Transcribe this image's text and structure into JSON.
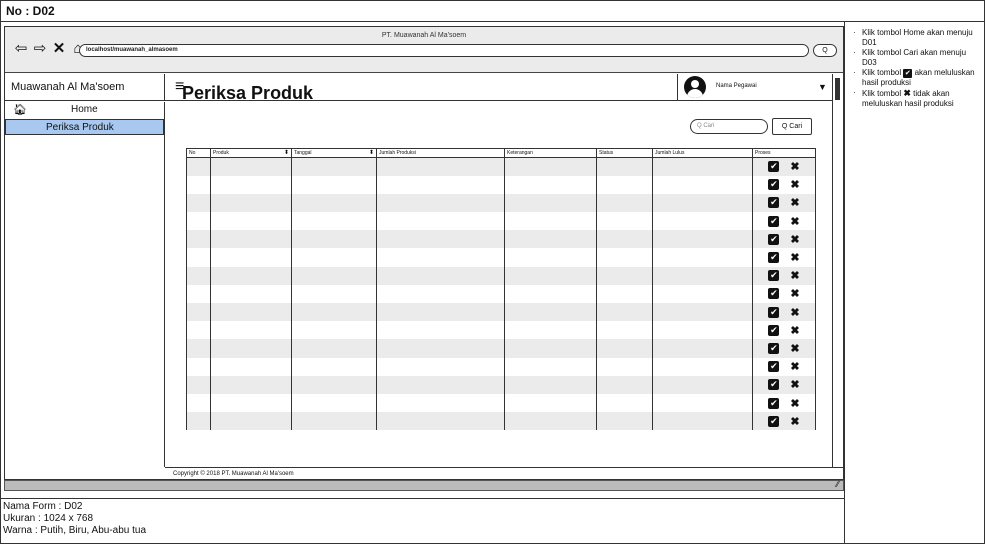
{
  "doc_id": "No : D02",
  "browser": {
    "window_title": "PT. Muawanah Al Ma'soem",
    "url": "localhost/muawanah_almasoem",
    "go_label": "Q"
  },
  "app": {
    "brand": "Muawanah Al Ma'soem",
    "hamburger": "≡",
    "user_name": "Nama Pegawai"
  },
  "sidebar": {
    "items": [
      {
        "label": "Home"
      },
      {
        "label": "Periksa Produk"
      }
    ]
  },
  "main": {
    "title": "Periksa Produk",
    "search_placeholder": "Q Cari",
    "search_button": "Q Cari",
    "columns": [
      "No",
      "Produk",
      "Tanggal",
      "Jumlah Produksi",
      "Keterangan",
      "Status",
      "Jumlah Lulus",
      "Proses"
    ],
    "row_count": 15
  },
  "footer": {
    "copyright": "Copyright © 2018 PT. Muawanah Al Ma'soem"
  },
  "form_info": {
    "name": "Nama Form : D02",
    "size": "Ukuran : 1024 x 768",
    "color": "Warna : Putih, Biru, Abu-abu tua"
  },
  "notes": {
    "n1": "Klik tombol Home akan menuju D01",
    "n2": "Klik tombol Cari akan menuju D03",
    "n3a": "Klik tombol",
    "n3b": "akan meluluskan hasil produksi",
    "n4a": "Klik tombol",
    "n4b": "tidak akan meluluskan hasil produksi"
  },
  "colors": {
    "active_menu": "#a9c8ef",
    "row_alt": "#ebebeb",
    "status_bar": "#bbbbbb"
  }
}
